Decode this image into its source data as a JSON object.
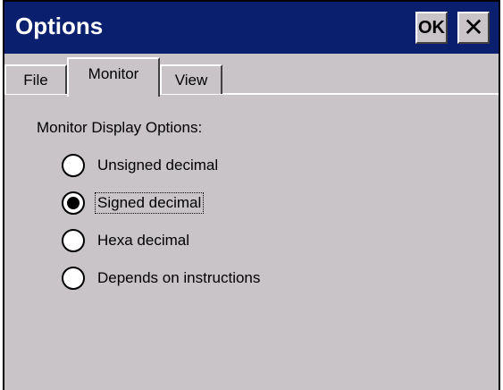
{
  "window": {
    "title": "Options",
    "ok_label": "OK",
    "close_glyph": "✕"
  },
  "tabs": [
    {
      "label": "File",
      "active": false
    },
    {
      "label": "Monitor",
      "active": true
    },
    {
      "label": "View",
      "active": false
    }
  ],
  "monitor": {
    "group_label": "Monitor Display Options:",
    "options": [
      {
        "label": "Unsigned decimal",
        "checked": false
      },
      {
        "label": "Signed decimal",
        "checked": true
      },
      {
        "label": "Hexa decimal",
        "checked": false
      },
      {
        "label": "Depends on instructions",
        "checked": false
      }
    ]
  },
  "colors": {
    "titlebar": "#0a1f6e",
    "face": "#c8c4c8"
  }
}
